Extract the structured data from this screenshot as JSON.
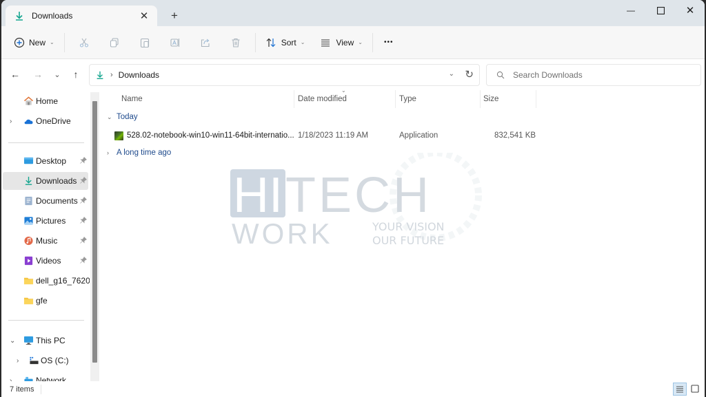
{
  "window": {
    "tab_title": "Downloads",
    "controls": {
      "minimize": "—",
      "maximize": "☐",
      "close": "✕"
    }
  },
  "commandbar": {
    "new_label": "New",
    "sort_label": "Sort",
    "view_label": "View",
    "more_label": "•••",
    "icons": [
      "plus-circle-icon",
      "cut-icon",
      "copy-icon",
      "paste-icon",
      "rename-icon",
      "share-icon",
      "delete-icon",
      "sort-icon",
      "view-icon",
      "more-icon"
    ]
  },
  "nav": {
    "back": "←",
    "forward": "→",
    "recent": "⌄",
    "up": "↑"
  },
  "address": {
    "breadcrumb": [
      "Downloads"
    ],
    "separator": "›"
  },
  "search": {
    "placeholder": "Search Downloads"
  },
  "sidebar": {
    "items": [
      {
        "label": "Home",
        "icon": "home-icon",
        "expander": "",
        "pinned": false
      },
      {
        "label": "OneDrive",
        "icon": "cloud-icon",
        "expander": "›",
        "pinned": false
      },
      {
        "label": "Desktop",
        "icon": "desktop-icon",
        "expander": "",
        "pinned": true
      },
      {
        "label": "Downloads",
        "icon": "download-icon",
        "expander": "",
        "pinned": true,
        "selected": true
      },
      {
        "label": "Documents",
        "icon": "documents-icon",
        "expander": "",
        "pinned": true
      },
      {
        "label": "Pictures",
        "icon": "pictures-icon",
        "expander": "",
        "pinned": true
      },
      {
        "label": "Music",
        "icon": "music-icon",
        "expander": "",
        "pinned": true
      },
      {
        "label": "Videos",
        "icon": "videos-icon",
        "expander": "",
        "pinned": true
      },
      {
        "label": "dell_g16_7620",
        "icon": "folder-icon",
        "expander": "",
        "pinned": false
      },
      {
        "label": "gfe",
        "icon": "folder-icon",
        "expander": "",
        "pinned": false
      },
      {
        "label": "This PC",
        "icon": "pc-icon",
        "expander": "⌄",
        "pinned": false
      },
      {
        "label": "OS (C:)",
        "icon": "drive-icon",
        "expander": "›",
        "pinned": false
      },
      {
        "label": "Network",
        "icon": "network-icon",
        "expander": "›",
        "pinned": false
      }
    ],
    "pin_glyph": "📌"
  },
  "columns": {
    "name": "Name",
    "date": "Date modified",
    "type": "Type",
    "size": "Size"
  },
  "groups": [
    {
      "label": "Today",
      "expanded": true,
      "chevron": "⌄",
      "files": [
        {
          "name": "528.02-notebook-win10-win11-64bit-internatio...",
          "date": "1/18/2023 11:19 AM",
          "type": "Application",
          "size": "832,541 KB"
        }
      ]
    },
    {
      "label": "A long time ago",
      "expanded": false,
      "chevron": "›"
    }
  ],
  "status": {
    "item_count": "7 items"
  },
  "watermark": {
    "line1": "HITECH",
    "line2": "WORK",
    "tagline1": "YOUR VISION",
    "tagline2": "OUR FUTURE"
  },
  "colors": {
    "accent": "#0f9d8a",
    "group_text": "#1e4a8c",
    "selected_bg": "#e6e6e6",
    "titlebar_bg": "#dfe5ea"
  }
}
